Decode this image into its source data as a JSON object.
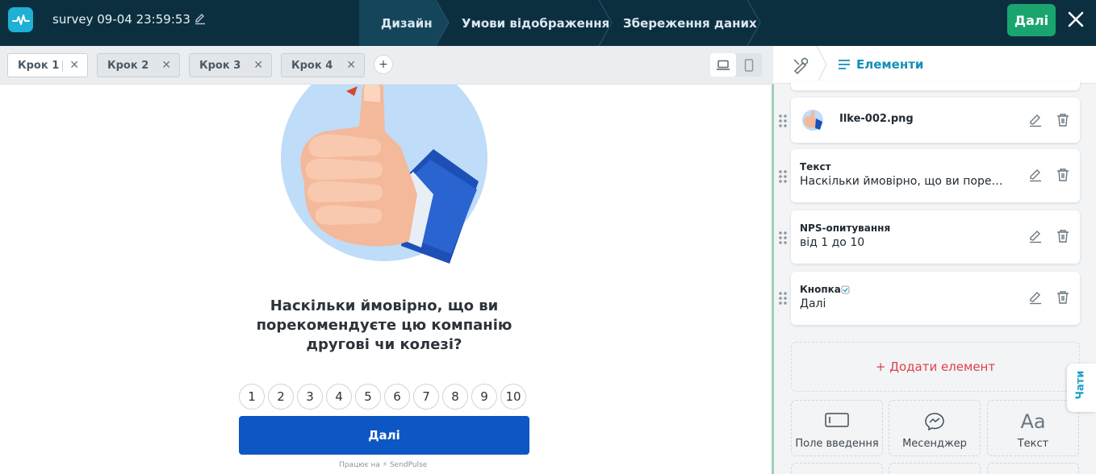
{
  "header": {
    "survey_title": "survey 09-04 23:59:53",
    "nav": [
      "Дизайн",
      "Умови відображення",
      "Збереження даних"
    ],
    "active_nav": "Дизайн",
    "next_label": "Далі"
  },
  "steps": {
    "tabs": [
      "Крок 1",
      "Крок 2",
      "Крок 3",
      "Крок 4"
    ],
    "active": "Крок 1",
    "add_label": "+"
  },
  "preview": {
    "question": "Наскільки ймовірно, що ви порекомендуєте цю компанію другові чи колезі?",
    "scale": [
      "1",
      "2",
      "3",
      "4",
      "5",
      "6",
      "7",
      "8",
      "9",
      "10"
    ],
    "next_label": "Далі",
    "powered_by": "Працює на ⚡ SendPulse"
  },
  "panel": {
    "title": "Елементи",
    "elements": [
      {
        "type": "",
        "value": "Ilke-002.png",
        "kind": "image"
      },
      {
        "type": "Текст",
        "value": "Наскільки ймовірно, що ви порек..."
      },
      {
        "type": "NPS-опитування",
        "value": "від 1 до 10"
      },
      {
        "type": "Кнопка",
        "value": "Далі"
      }
    ],
    "add_element": "+ Додати елемент",
    "tools": [
      "Поле введення",
      "Месенджер",
      "Текст"
    ],
    "chats_label": "Чати"
  },
  "colors": {
    "topbar": "#0c2f40",
    "accent_green": "#1aa56e",
    "preview_button": "#0d57c4",
    "panel_title": "#1291b7",
    "add_element": "#e0414a"
  }
}
